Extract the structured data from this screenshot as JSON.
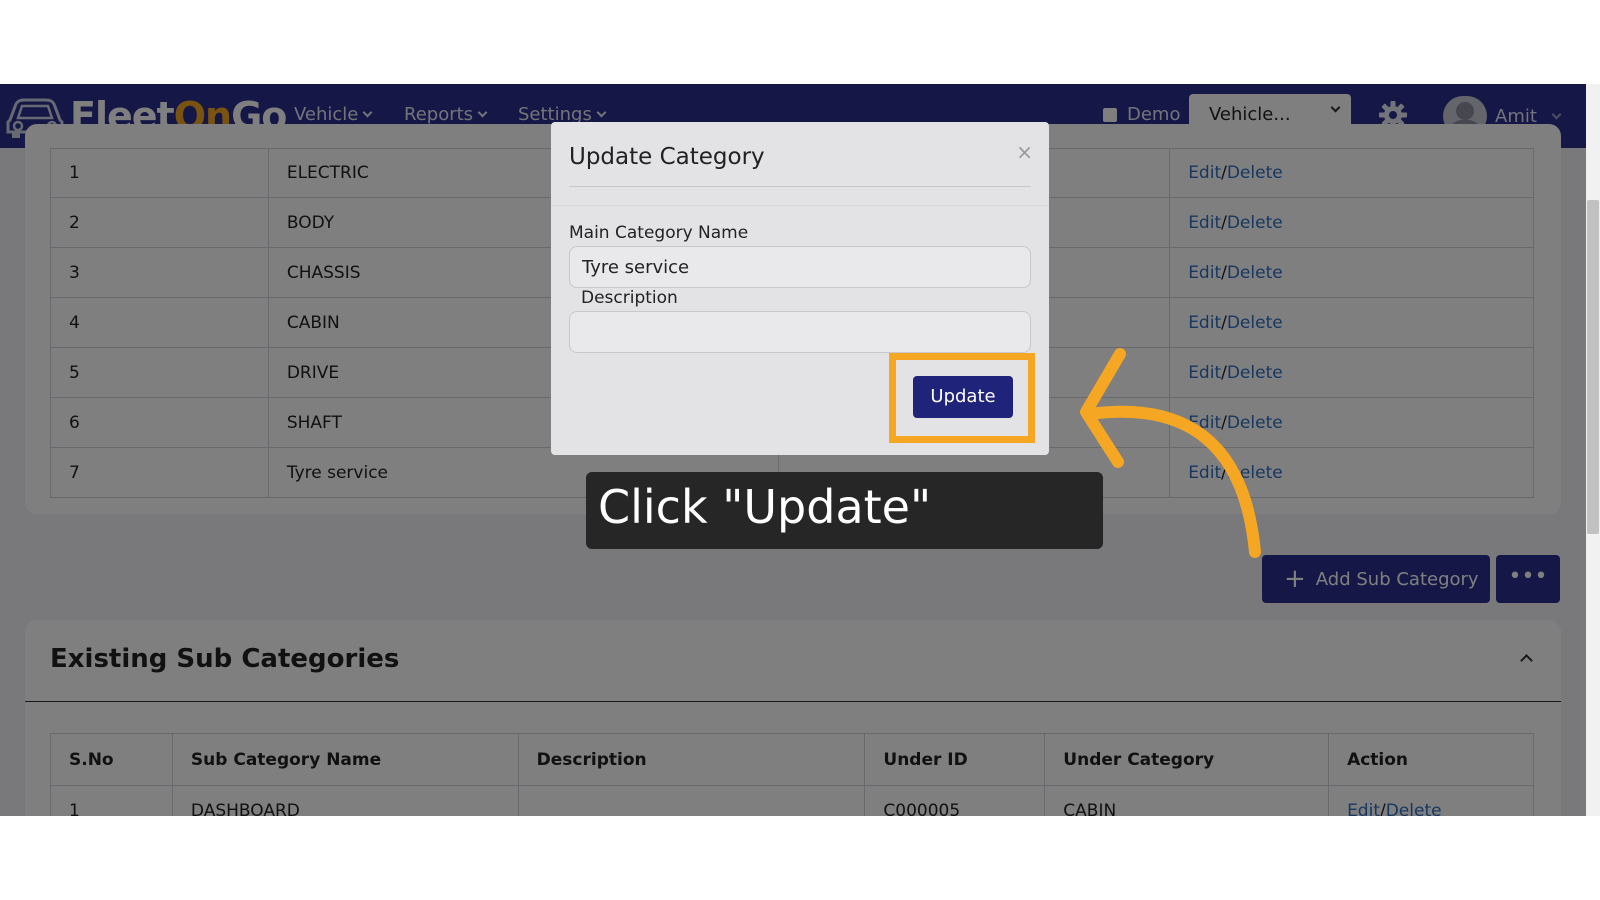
{
  "navbar": {
    "logo_part1": "Fleet",
    "logo_part2": "On",
    "logo_part3": "Go",
    "menu": [
      "Vehicle",
      "Reports",
      "Settings"
    ],
    "demo_label": "Demo",
    "vehicle_select": "Vehicle...",
    "user_name": "Amit"
  },
  "categories_table": {
    "rows": [
      {
        "sno": "1",
        "name": "ELECTRIC"
      },
      {
        "sno": "2",
        "name": "BODY"
      },
      {
        "sno": "3",
        "name": "CHASSIS"
      },
      {
        "sno": "4",
        "name": "CABIN"
      },
      {
        "sno": "5",
        "name": "DRIVE"
      },
      {
        "sno": "6",
        "name": "SHAFT"
      },
      {
        "sno": "7",
        "name": "Tyre service"
      }
    ],
    "edit_label": "Edit",
    "delete_label": "Delete",
    "action_sep": "/"
  },
  "add_sub_category_label": "Add Sub Category",
  "more_label": "•••",
  "sub_categories": {
    "title": "Existing Sub Categories",
    "headers": [
      "S.No",
      "Sub Category Name",
      "Description",
      "Under ID",
      "Under Category",
      "Action"
    ],
    "rows": [
      {
        "sno": "1",
        "name": "DASHBOARD",
        "description": "",
        "under_id": "C000005",
        "under_category": "CABIN"
      }
    ]
  },
  "modal": {
    "title": "Update Category",
    "close": "×",
    "main_category_label": "Main Category Name",
    "main_category_value": "Tyre service",
    "description_label": "Description",
    "description_value": "",
    "update_label": "Update"
  },
  "tooltip": "Click \"Update\"",
  "colors": {
    "navbar": "#2b2f8f",
    "accent": "#f5a623",
    "link": "#2f6fc2",
    "update_button": "#20237a"
  }
}
